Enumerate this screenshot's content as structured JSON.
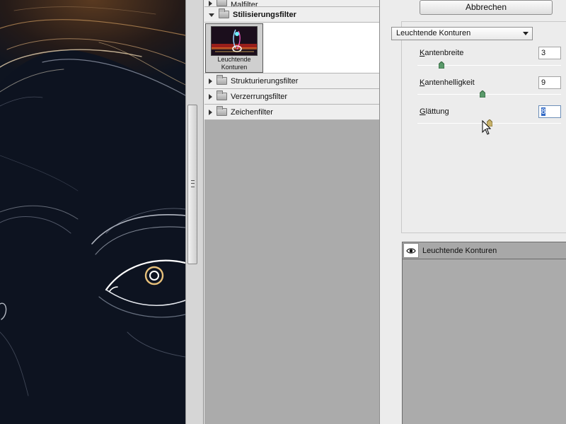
{
  "gallery": {
    "categories_above": [
      {
        "label": "Malfilter",
        "expanded": false
      }
    ],
    "active_category": {
      "label": "Stilisierungsfilter",
      "expanded": true
    },
    "thumbnail": {
      "label": "Leuchtende\nKonturen",
      "selected": true
    },
    "categories_below": [
      {
        "label": "Strukturierungsfilter",
        "expanded": false
      },
      {
        "label": "Verzerrungsfilter",
        "expanded": false
      },
      {
        "label": "Zeichenfilter",
        "expanded": false
      }
    ]
  },
  "settings": {
    "cancel_label": "Abbrechen",
    "filter_select": "Leuchtende Konturen",
    "params": [
      {
        "label": "Kantenbreite",
        "underline": "K",
        "rest": "antenbreite",
        "value": "3",
        "min": 1,
        "max": 14,
        "level": 3
      },
      {
        "label": "Kantenhelligkeit",
        "underline": "K",
        "rest": "antenhelligkeit",
        "value": "9",
        "min": 0,
        "max": 20,
        "level": 9
      },
      {
        "label": "Glättung",
        "underline": "G",
        "rest": "lättung",
        "value": "8",
        "min": 1,
        "max": 15,
        "level": 8
      }
    ]
  },
  "layers": {
    "items": [
      {
        "name": "Leuchtende Konturen",
        "visible": true
      }
    ]
  },
  "colors": {
    "preview_bg": "#0e1420",
    "panel_gray": "#ababab",
    "selection_blue": "#3169c6"
  }
}
